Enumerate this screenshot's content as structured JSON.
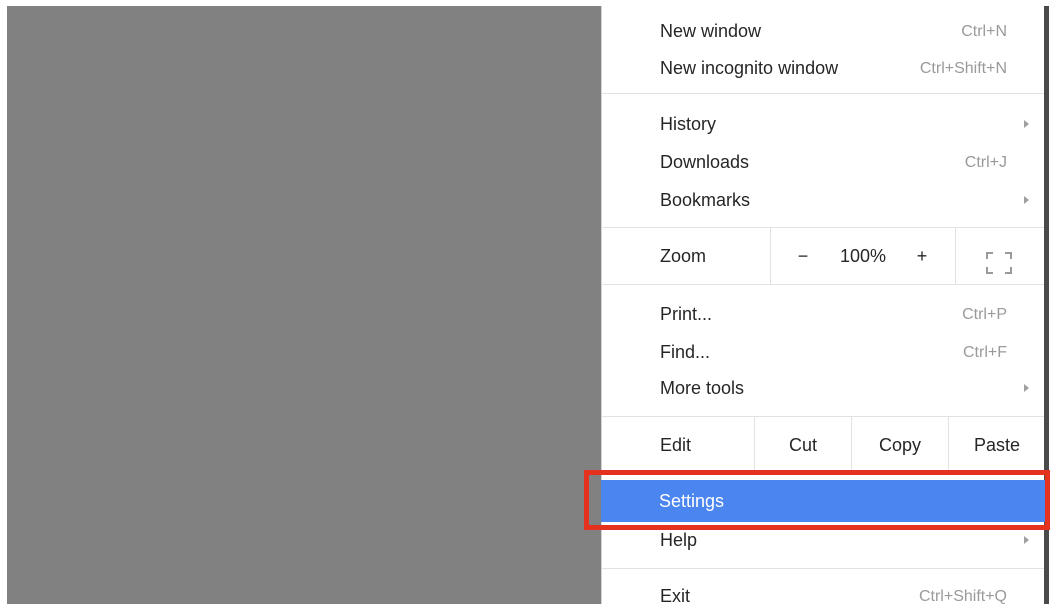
{
  "menu": {
    "new_window": {
      "label": "New window",
      "shortcut": "Ctrl+N"
    },
    "new_incognito": {
      "label": "New incognito window",
      "shortcut": "Ctrl+Shift+N"
    },
    "history": {
      "label": "History",
      "icon": "chevron-right-icon"
    },
    "downloads": {
      "label": "Downloads",
      "shortcut": "Ctrl+J"
    },
    "bookmarks": {
      "label": "Bookmarks",
      "icon": "chevron-right-icon"
    },
    "zoom": {
      "label": "Zoom",
      "minus": "−",
      "level": "100%",
      "plus": "+",
      "fullscreen_icon": "fullscreen-icon"
    },
    "print": {
      "label": "Print...",
      "shortcut": "Ctrl+P"
    },
    "find": {
      "label": "Find...",
      "shortcut": "Ctrl+F"
    },
    "more_tools": {
      "label": "More tools",
      "icon": "chevron-right-icon"
    },
    "edit": {
      "label": "Edit",
      "cut": "Cut",
      "copy": "Copy",
      "paste": "Paste"
    },
    "settings": {
      "label": "Settings",
      "highlighted": true
    },
    "help": {
      "label": "Help",
      "icon": "chevron-right-icon"
    },
    "exit": {
      "label": "Exit",
      "shortcut": "Ctrl+Shift+Q"
    }
  },
  "colors": {
    "highlight": "#4a85f0",
    "annotation_box": "#e5321f",
    "backdrop": "#818181"
  }
}
